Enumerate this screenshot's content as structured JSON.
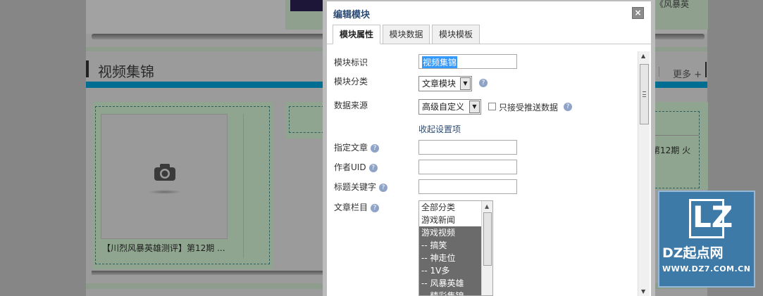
{
  "background_page": {
    "top_right_text": "《风暴英",
    "section_title": "视频集锦",
    "more_link": "更多 +",
    "video_caption": "【川烈风暴英雄测评】第12期 ...",
    "right_snippet": "第12期 火"
  },
  "watermark": {
    "logo_letters": "LZ",
    "name": "DZ起点网",
    "url": "WWW.DZ7.COM.CN"
  },
  "modal": {
    "title": "编辑模块",
    "close_label": "×",
    "tabs": [
      {
        "label": "模块属性",
        "active": true
      },
      {
        "label": "模块数据",
        "active": false
      },
      {
        "label": "模块模板",
        "active": false
      }
    ],
    "form": {
      "module_id_label": "模块标识",
      "module_id_value": "视频集锦",
      "module_category_label": "模块分类",
      "module_category_value": "文章模块",
      "data_source_label": "数据来源",
      "data_source_value": "高级自定义",
      "push_only_label": "只接受推送数据",
      "collapse_link": "收起设置项",
      "specify_article_label": "指定文章",
      "author_uid_label": "作者UID",
      "title_keyword_label": "标题关键字",
      "article_column_label": "文章栏目",
      "columns": [
        {
          "label": "全部分类",
          "selected": false
        },
        {
          "label": "游戏新闻",
          "selected": false
        },
        {
          "label": "游戏视频",
          "selected": true
        },
        {
          "label": "-- 搞笑",
          "selected": true
        },
        {
          "label": "-- 神走位",
          "selected": true
        },
        {
          "label": "-- 1V多",
          "selected": true
        },
        {
          "label": "-- 风暴英雄",
          "selected": true
        },
        {
          "label": "-- 精彩集锦",
          "selected": true
        }
      ]
    }
  },
  "colors": {
    "modal_title": "#2b4a74",
    "selection": "#3399ff",
    "list_selected": "#6b6b6b",
    "watermark_bg": "#3e7aa8"
  }
}
